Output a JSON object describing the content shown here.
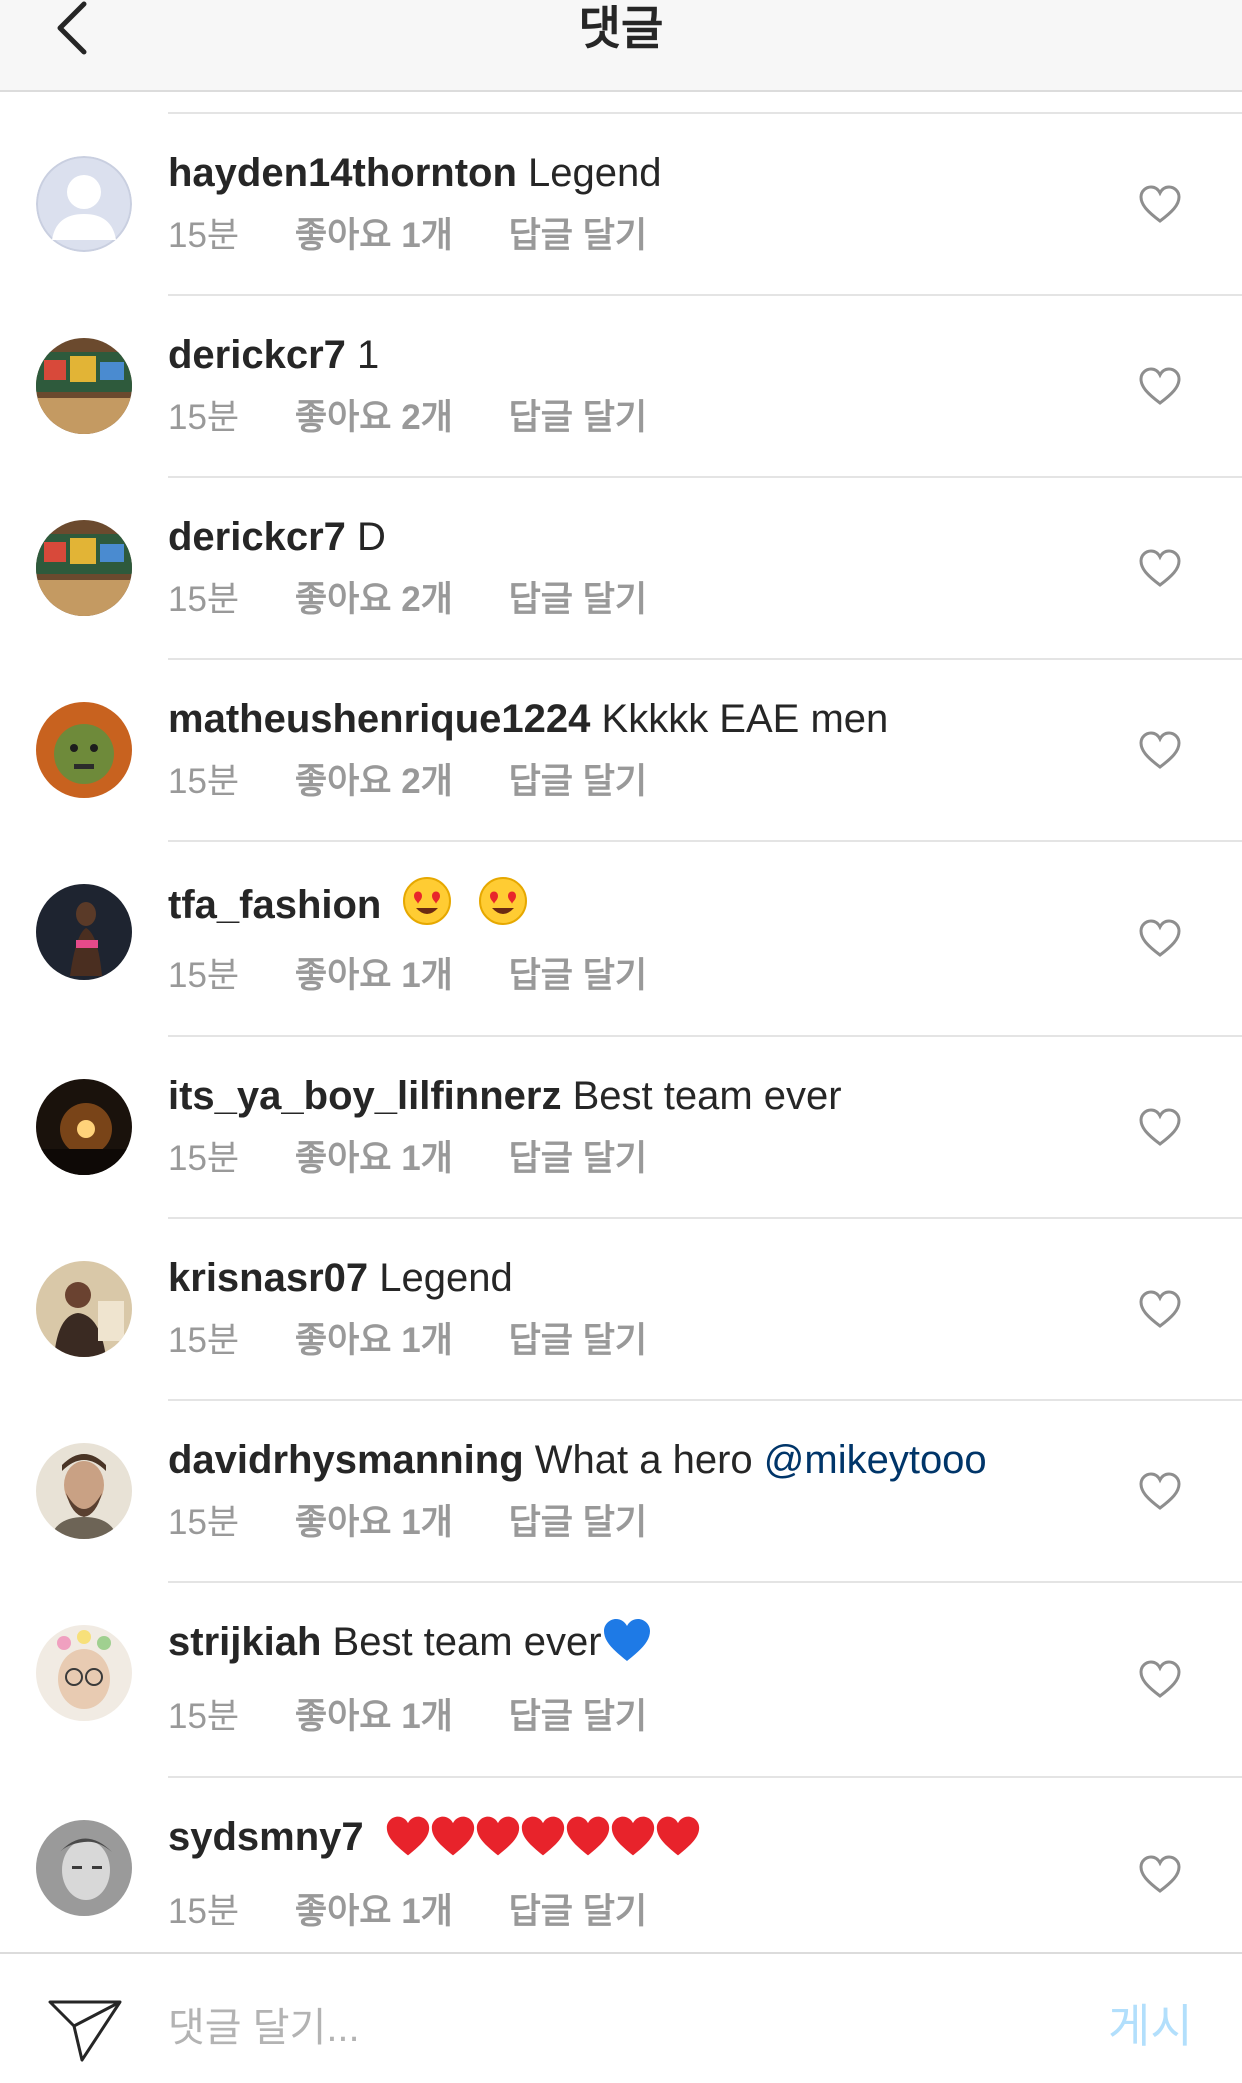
{
  "header": {
    "title": "댓글",
    "back_icon": "chevron-left-icon"
  },
  "comments": [
    {
      "username": "hayden14thornton",
      "text": "Legend",
      "time": "15분",
      "likes": "좋아요 1개",
      "reply": "답글 달기",
      "avatar": "default-silhouette"
    },
    {
      "username": "derickcr7",
      "text": "1",
      "time": "15분",
      "likes": "좋아요 2개",
      "reply": "답글 달기",
      "avatar": "graffiti-wall-photo"
    },
    {
      "username": "derickcr7",
      "text": "D",
      "time": "15분",
      "likes": "좋아요 2개",
      "reply": "답글 달기",
      "avatar": "graffiti-wall-photo"
    },
    {
      "username": "matheushenrique1224",
      "text": "Kkkkk EAE men",
      "time": "15분",
      "likes": "좋아요 2개",
      "reply": "답글 달기",
      "avatar": "green-face-photo"
    },
    {
      "username": "tfa_fashion",
      "text": "",
      "emojis": [
        "heart-eyes-emoji",
        "heart-eyes-emoji"
      ],
      "time": "15분",
      "likes": "좋아요 1개",
      "reply": "답글 달기",
      "avatar": "fashion-model-photo"
    },
    {
      "username": "its_ya_boy_lilfinnerz",
      "text": "Best team ever",
      "time": "15분",
      "likes": "좋아요 1개",
      "reply": "답글 달기",
      "avatar": "sunset-photo"
    },
    {
      "username": "krisnasr07",
      "text": "Legend",
      "time": "15분",
      "likes": "좋아요 1개",
      "reply": "답글 달기",
      "avatar": "person-sitting-photo"
    },
    {
      "username": "davidrhysmanning",
      "text": "What a hero",
      "mention": "@mikeytooo",
      "time": "15분",
      "likes": "좋아요 1개",
      "reply": "답글 달기",
      "avatar": "bearded-man-photo"
    },
    {
      "username": "strijkiah",
      "text": "Best team ever",
      "emojis": [
        "blue-heart-emoji"
      ],
      "time": "15분",
      "likes": "좋아요 1개",
      "reply": "답글 달기",
      "avatar": "flower-filter-photo"
    },
    {
      "username": "sydsmny7",
      "text": "",
      "emojis": [
        "red-heart-emoji",
        "red-heart-emoji",
        "red-heart-emoji",
        "red-heart-emoji",
        "red-heart-emoji",
        "red-heart-emoji",
        "red-heart-emoji"
      ],
      "time": "15분",
      "likes": "좋아요 1개",
      "reply": "답글 달기",
      "avatar": "bw-portrait-photo"
    }
  ],
  "composer": {
    "placeholder": "댓글 달기...",
    "post_label": "게시",
    "send_icon": "paper-plane-icon"
  },
  "colors": {
    "text": "#262626",
    "meta": "#999999",
    "mention": "#003569",
    "post_disabled": "#b2dffc",
    "divider": "#e4e4e4"
  }
}
